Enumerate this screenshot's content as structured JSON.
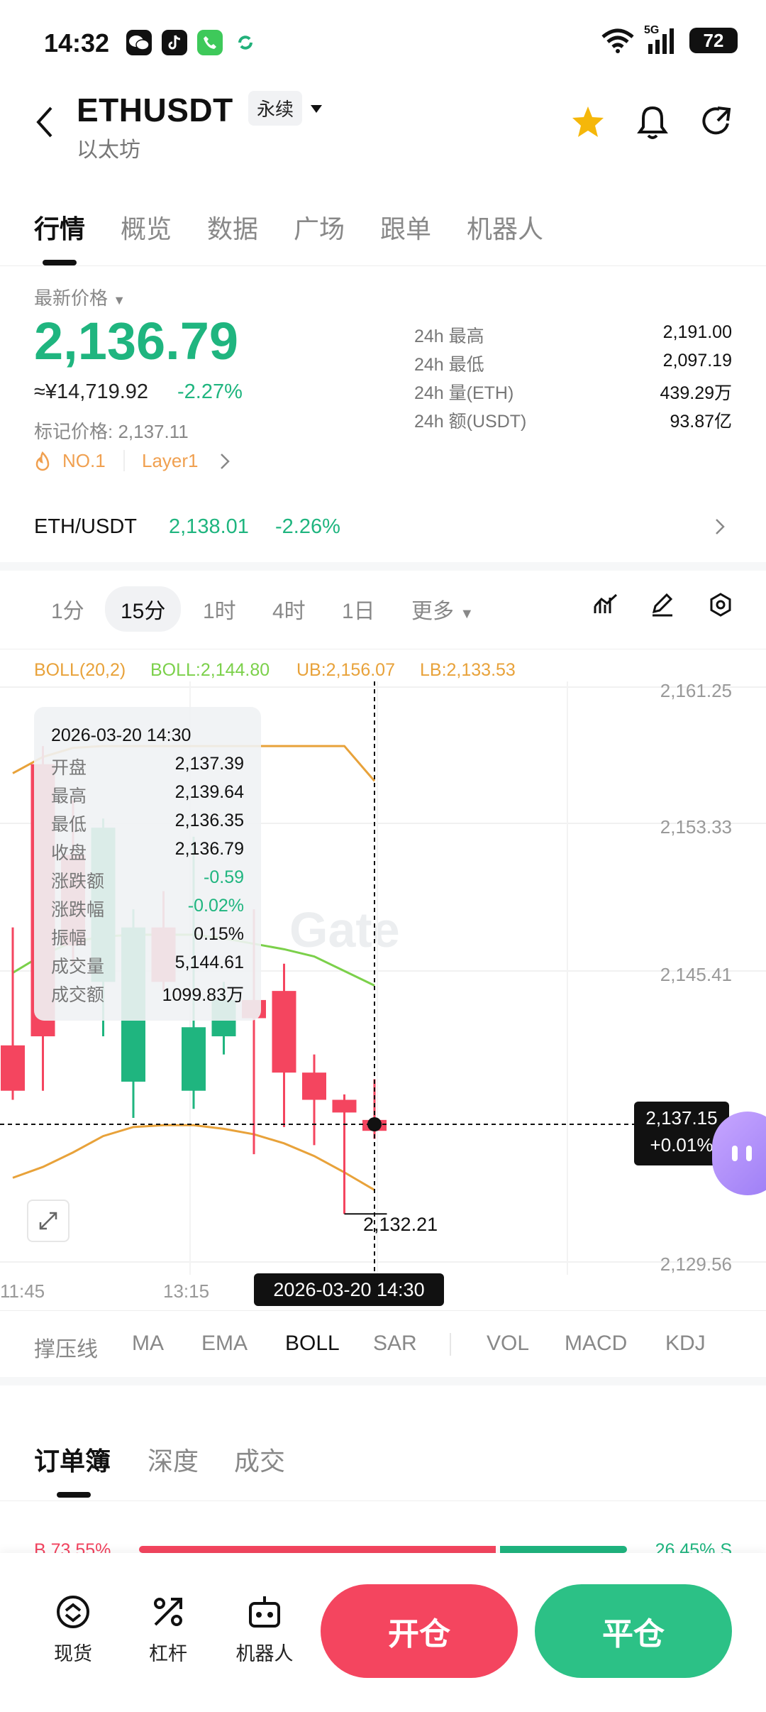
{
  "status_bar": {
    "time": "14:32",
    "battery": "72",
    "network": "5G",
    "apps": [
      "wechat-icon",
      "tiktok-icon",
      "phone-icon",
      "refresh-icon"
    ]
  },
  "header": {
    "symbol": "ETHUSDT",
    "contract_type": "永续",
    "name": "以太坊"
  },
  "tabs": [
    "行情",
    "概览",
    "数据",
    "广场",
    "跟单",
    "机器人"
  ],
  "price": {
    "label": "最新价格",
    "last": "2,136.79",
    "cny": "≈¥14,719.92",
    "change": "-2.27%",
    "mark_price": "标记价格: 2,137.11",
    "rank_tag": "NO.1",
    "category_tag": "Layer1"
  },
  "stats": [
    {
      "key": "24h  最高",
      "value": "2,191.00"
    },
    {
      "key": "24h  最低",
      "value": "2,097.19"
    },
    {
      "key": "24h  量(ETH)",
      "value": "439.29万"
    },
    {
      "key": "24h  额(USDT)",
      "value": "93.87亿"
    }
  ],
  "spot": {
    "pair": "ETH/USDT",
    "price": "2,138.01",
    "change": "-2.26%"
  },
  "intervals": [
    "1分",
    "15分",
    "1时",
    "4时",
    "1日",
    "更多"
  ],
  "boll": {
    "name": "BOLL(20,2)",
    "mid": "BOLL:2,144.80",
    "ub": "UB:2,156.07",
    "lb": "LB:2,133.53"
  },
  "y_axis": [
    "2,161.25",
    "2,153.33",
    "2,145.41",
    "2,129.56"
  ],
  "x_axis": [
    "11:45",
    "13:15"
  ],
  "tooltip": {
    "date": "2026-03-20 14:30",
    "rows": [
      {
        "key": "开盘",
        "value": "2,137.39"
      },
      {
        "key": "最高",
        "value": "2,139.64"
      },
      {
        "key": "最低",
        "value": "2,136.35"
      },
      {
        "key": "收盘",
        "value": "2,136.79"
      },
      {
        "key": "涨跌额",
        "value": "-0.59"
      },
      {
        "key": "涨跌幅",
        "value": "-0.02%"
      },
      {
        "key": "振幅",
        "value": "0.15%"
      },
      {
        "key": "成交量",
        "value": "5,144.61"
      },
      {
        "key": "成交额",
        "value": "1099.83万"
      }
    ]
  },
  "crosshair": {
    "price": "2,137.15",
    "change": "+0.01%",
    "date": "2026-03-20 14:30",
    "low_marker": "2,132.21"
  },
  "watermark": "Gate",
  "indicators": [
    "撑压线",
    "MA",
    "EMA",
    "BOLL",
    "SAR",
    "VOL",
    "MACD",
    "KDJ"
  ],
  "orderbook_tabs": [
    "订单簿",
    "深度",
    "成交"
  ],
  "ratio": {
    "buy": "B 73.55%",
    "sell": "26.45% S",
    "buy_fraction": 0.7355
  },
  "bottom_bar": {
    "spot": "现货",
    "leverage": "杠杆",
    "robot": "机器人",
    "open": "开仓",
    "close": "平仓"
  },
  "colors": {
    "up": "#1fb57f",
    "down": "#f4455f",
    "boll_band": "#e8a23a",
    "boll_mid": "#7bd04a"
  },
  "chart_data": {
    "type": "candlestick",
    "candles": [
      {
        "open": 2141.5,
        "close": 2139.0,
        "high": 2148.0,
        "low": 2138.5
      },
      {
        "open": 2157.0,
        "close": 2142.0,
        "high": 2158.0,
        "low": 2139.0
      },
      {
        "open": 2152.0,
        "close": 2147.0,
        "high": 2155.0,
        "low": 2146.0
      },
      {
        "open": 2145.0,
        "close": 2153.5,
        "high": 2154.0,
        "low": 2142.0
      },
      {
        "open": 2139.5,
        "close": 2148.0,
        "high": 2149.0,
        "low": 2137.5
      },
      {
        "open": 2148.0,
        "close": 2145.0,
        "high": 2150.0,
        "low": 2144.5
      },
      {
        "open": 2139.0,
        "close": 2142.5,
        "high": 2153.0,
        "low": 2138.0
      },
      {
        "open": 2142.0,
        "close": 2144.0,
        "high": 2145.0,
        "low": 2141.0
      },
      {
        "open": 2144.0,
        "close": 2143.0,
        "high": 2149.0,
        "low": 2135.5
      },
      {
        "open": 2144.5,
        "close": 2140.0,
        "high": 2146.0,
        "low": 2137.0
      },
      {
        "open": 2140.0,
        "close": 2138.5,
        "high": 2141.0,
        "low": 2136.0
      },
      {
        "open": 2138.5,
        "close": 2137.8,
        "high": 2138.8,
        "low": 2132.21
      },
      {
        "open": 2137.39,
        "close": 2136.79,
        "high": 2139.64,
        "low": 2136.35
      }
    ],
    "ub_line": [
      2156.5,
      2157.4,
      2157.9,
      2158.0,
      2158.0,
      2158.0,
      2158.0,
      2158.0,
      2158.0,
      2158.0,
      2158.0,
      2158.0,
      2156.07
    ],
    "mid_line": [
      2145.5,
      2146.5,
      2147.2,
      2147.5,
      2147.6,
      2147.6,
      2147.6,
      2147.4,
      2147.1,
      2146.8,
      2146.4,
      2145.6,
      2144.8
    ],
    "lb_line": [
      2134.2,
      2134.8,
      2135.6,
      2136.5,
      2137.0,
      2137.1,
      2137.1,
      2136.9,
      2136.6,
      2136.1,
      2135.4,
      2134.5,
      2133.53
    ],
    "ylim": [
      2129.56,
      2161.25
    ]
  }
}
